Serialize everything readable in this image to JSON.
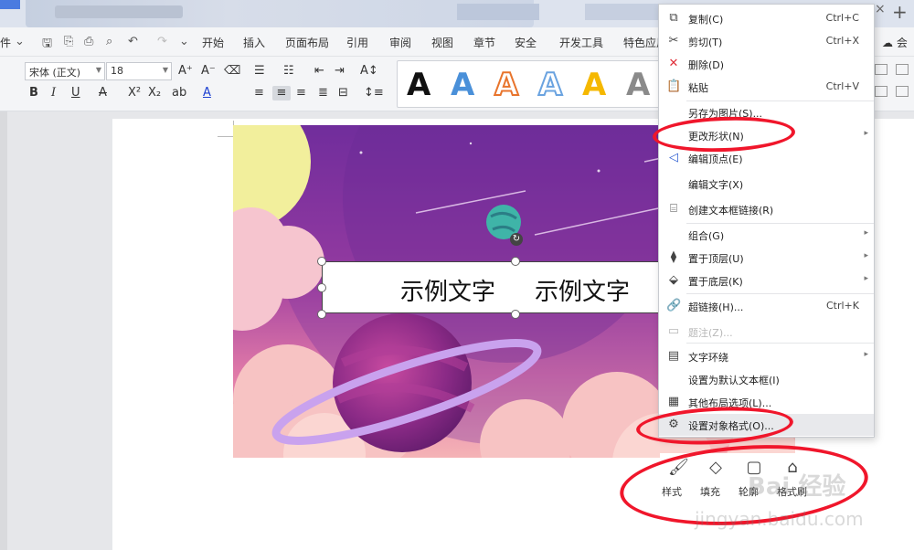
{
  "titlebar": {
    "close_glyph": "×",
    "new_tab_glyph": "+"
  },
  "menubar": {
    "file_label": "件",
    "items": [
      "开始",
      "插入",
      "页面布局",
      "引用",
      "审阅",
      "视图",
      "章节",
      "安全",
      "开发工具",
      "特色应用"
    ],
    "cloud_label": "会"
  },
  "ribbon": {
    "font_name": "宋体 (正文)",
    "font_size": "18",
    "art_letter": "A",
    "art_colors": [
      "#111111",
      "#4a90d9",
      "#e8742c",
      "#6aa3e0",
      "#f5b800",
      "#8a8a8a"
    ]
  },
  "textbox": {
    "text1": "示例文字",
    "text2": "示例文字"
  },
  "context_menu": {
    "items": [
      {
        "label": "复制(C)",
        "shortcut": "Ctrl+C",
        "icon": "copy-icon",
        "glyph": "⧉"
      },
      {
        "label": "剪切(T)",
        "shortcut": "Ctrl+X",
        "icon": "scissors-icon",
        "glyph": "✂"
      },
      {
        "label": "删除(D)",
        "shortcut": "",
        "icon": "delete-icon",
        "glyph": "✕"
      },
      {
        "label": "粘贴",
        "shortcut": "Ctrl+V",
        "icon": "paste-icon",
        "glyph": "📋"
      },
      {
        "label": "另存为图片(S)...",
        "shortcut": "",
        "icon": "",
        "glyph": ""
      },
      {
        "label": "更改形状(N)",
        "shortcut": "",
        "icon": "",
        "glyph": "",
        "submenu": true
      },
      {
        "label": "编辑顶点(E)",
        "shortcut": "",
        "icon": "edit-points-icon",
        "glyph": "◁"
      },
      {
        "label": "编辑文字(X)",
        "shortcut": "",
        "icon": "",
        "glyph": ""
      },
      {
        "label": "创建文本框链接(R)",
        "shortcut": "",
        "icon": "link-textbox-icon",
        "glyph": "⌸"
      },
      {
        "label": "组合(G)",
        "shortcut": "",
        "icon": "",
        "glyph": "",
        "submenu": true
      },
      {
        "label": "置于顶层(U)",
        "shortcut": "",
        "icon": "bring-front-icon",
        "glyph": "⧫",
        "submenu": true
      },
      {
        "label": "置于底层(K)",
        "shortcut": "",
        "icon": "send-back-icon",
        "glyph": "⬙",
        "submenu": true
      },
      {
        "label": "超链接(H)...",
        "shortcut": "Ctrl+K",
        "icon": "hyperlink-icon",
        "glyph": "🔗"
      },
      {
        "label": "题注(Z)...",
        "shortcut": "",
        "icon": "caption-icon",
        "glyph": "▭",
        "disabled": true
      },
      {
        "label": "文字环绕",
        "shortcut": "",
        "icon": "text-wrap-icon",
        "glyph": "▤",
        "submenu": true
      },
      {
        "label": "设置为默认文本框(I)",
        "shortcut": "",
        "icon": "",
        "glyph": ""
      },
      {
        "label": "其他布局选项(L)...",
        "shortcut": "",
        "icon": "layout-icon",
        "glyph": "▦"
      },
      {
        "label": "设置对象格式(O)...",
        "shortcut": "",
        "icon": "format-object-icon",
        "glyph": "⚙",
        "highlighted": true
      }
    ],
    "submenu_arrow": "▸"
  },
  "mini_toolbar": {
    "items": [
      {
        "label": "样式",
        "icon": "brush-icon",
        "glyph": "🖌"
      },
      {
        "label": "填充",
        "icon": "fill-icon",
        "glyph": "◇"
      },
      {
        "label": "轮廓",
        "icon": "outline-icon",
        "glyph": "▢"
      },
      {
        "label": "格式刷",
        "icon": "format-painter-icon",
        "glyph": "⌂"
      }
    ]
  },
  "watermark": {
    "line1": "Bai 经验",
    "line2": "jingyan.baidu.com"
  },
  "colors": {
    "accent": "#4a7be0",
    "annotation": "#f0162b"
  }
}
